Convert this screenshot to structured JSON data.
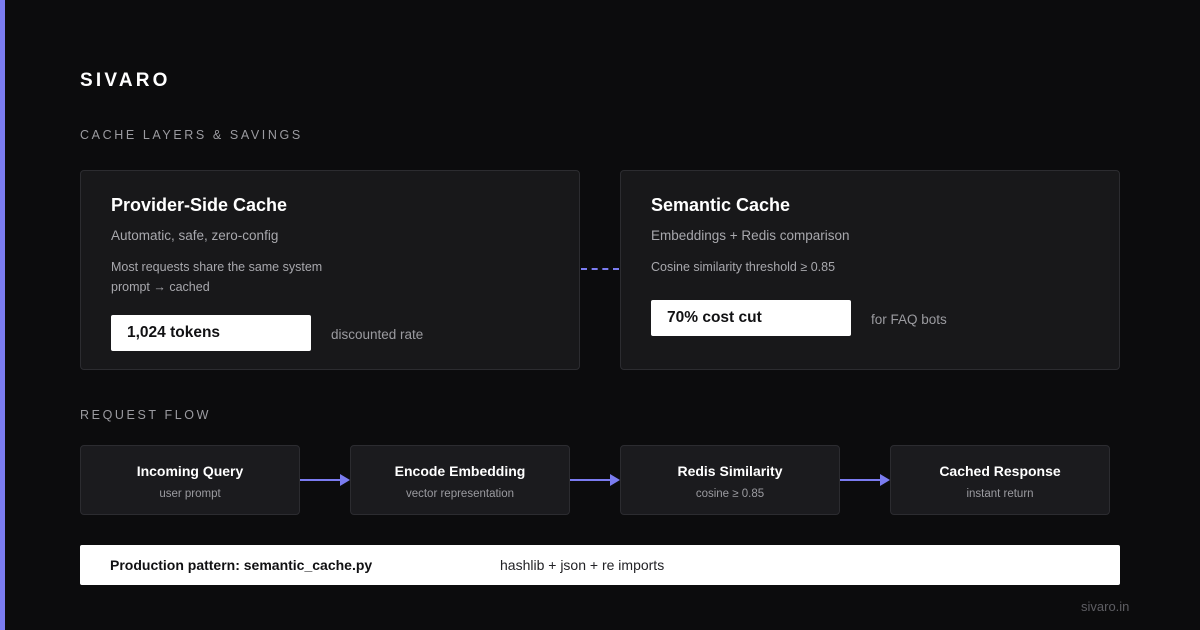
{
  "brand": "SIVARO",
  "sections": {
    "cache_label": "CACHE LAYERS & SAVINGS",
    "flow_label": "REQUEST FLOW"
  },
  "cards": {
    "provider": {
      "title": "Provider-Side Cache",
      "subtitle": "Automatic, safe, zero-config",
      "note": "Most requests share the same system prompt → cached",
      "highlight": "1,024 tokens",
      "highlight_note": "discounted rate"
    },
    "semantic": {
      "title": "Semantic Cache",
      "subtitle": "Embeddings + Redis comparison",
      "note": "Cosine similarity threshold ≥ 0.85",
      "highlight": "70% cost cut",
      "highlight_note": "for FAQ bots"
    }
  },
  "flow": [
    {
      "title": "Incoming Query",
      "subtitle": "user prompt"
    },
    {
      "title": "Encode Embedding",
      "subtitle": "vector representation"
    },
    {
      "title": "Redis Similarity",
      "subtitle": "cosine ≥ 0.85"
    },
    {
      "title": "Cached Response",
      "subtitle": "instant return"
    }
  ],
  "footer": {
    "title": "Production pattern: semantic_cache.py",
    "note": "hashlib + json + re imports"
  },
  "site": "sivaro.in",
  "colors": {
    "background": "#0c0c0d",
    "accent": "#7b7cf0",
    "card": "#18181a",
    "highlight_bg": "#ffffff"
  }
}
